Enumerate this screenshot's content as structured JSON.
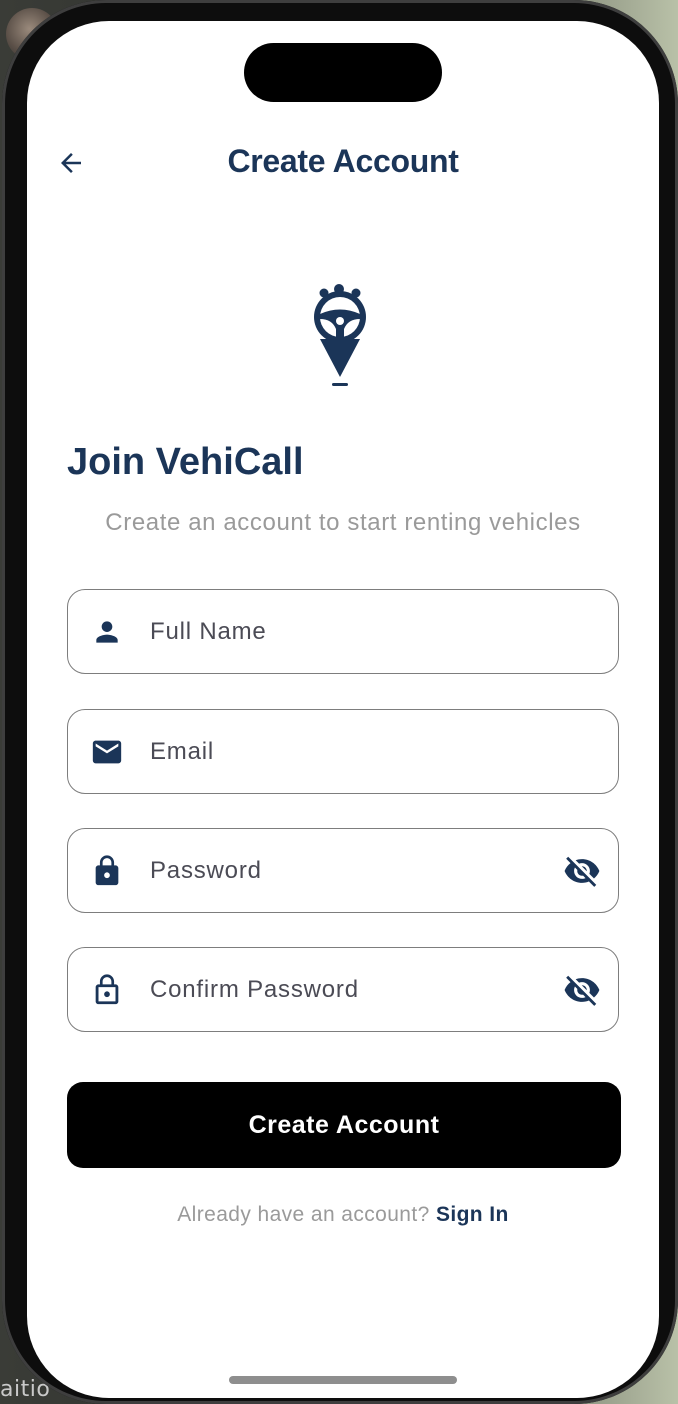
{
  "header": {
    "title": "Create Account",
    "back_icon": "arrow-back-icon"
  },
  "brand": {
    "logo_icon": "steering-wheel-pin-logo",
    "heading": "Join VehiCall",
    "subtitle": "Create an account to start renting vehicles"
  },
  "form": {
    "full_name": {
      "placeholder": "Full Name",
      "value": "",
      "icon": "person-icon"
    },
    "email": {
      "placeholder": "Email",
      "value": "",
      "icon": "mail-icon"
    },
    "password": {
      "placeholder": "Password",
      "value": "",
      "icon": "lock-icon",
      "toggle_icon": "visibility-off-icon"
    },
    "confirm_password": {
      "placeholder": "Confirm Password",
      "value": "",
      "icon": "lock-outline-icon",
      "toggle_icon": "visibility-off-icon"
    }
  },
  "actions": {
    "submit_label": "Create Account"
  },
  "footer": {
    "prompt": "Already have an account?",
    "link_label": "Sign In"
  },
  "background": {
    "partial_text": "aitio"
  },
  "colors": {
    "primary": "#1b3558",
    "button": "#000000",
    "muted_text": "#9a9a9a",
    "field_border": "#7d7d7d"
  }
}
